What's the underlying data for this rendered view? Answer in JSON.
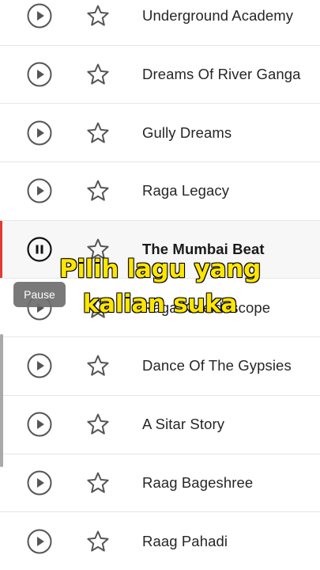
{
  "tracks": [
    {
      "title": "Underground Academy",
      "state": "play"
    },
    {
      "title": "Dreams Of River Ganga",
      "state": "play"
    },
    {
      "title": "Gully Dreams",
      "state": "play"
    },
    {
      "title": "Raga Legacy",
      "state": "play"
    },
    {
      "title": "The Mumbai Beat",
      "state": "pause"
    },
    {
      "title": "Raga Kaleidoscope",
      "state": "play"
    },
    {
      "title": "Dance Of The Gypsies",
      "state": "play"
    },
    {
      "title": "A Sitar Story",
      "state": "play"
    },
    {
      "title": "Raag Bageshree",
      "state": "play"
    },
    {
      "title": "Raag Pahadi",
      "state": "play"
    }
  ],
  "tooltip": {
    "label": "Pause"
  },
  "caption": {
    "line1": "Pilih lagu yang",
    "line2": "kalian suka"
  },
  "colors": {
    "accent": "#e53935",
    "caption_fill": "#ffe600",
    "caption_outline": "#000000",
    "icon": "#555555"
  },
  "icons": {
    "play": "play-circle-icon",
    "pause": "pause-circle-icon",
    "favorite": "star-outline-icon"
  }
}
